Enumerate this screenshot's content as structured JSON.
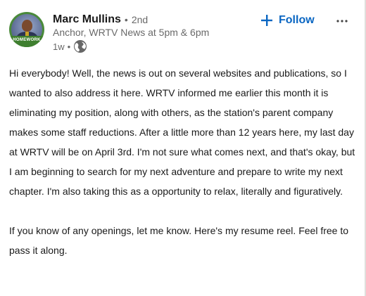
{
  "author": {
    "name": "Marc Mullins",
    "separator": "•",
    "connection_degree": "2nd",
    "headline": "Anchor, WRTV News at 5pm & 6pm",
    "avatar_banner_text": "HOMEWORK",
    "avatar_icon": "profile-photo"
  },
  "post_meta": {
    "time_ago": "1w",
    "separator": "•",
    "visibility_icon": "globe-icon"
  },
  "actions": {
    "follow_label": "Follow",
    "follow_icon": "plus-icon",
    "more_icon": "ellipsis-icon"
  },
  "content": {
    "paragraphs": [
      "Hi everybody! Well, the news is out on several websites and publications, so I wanted to also address it here. WRTV informed me earlier this month it is eliminating my position, along with others, as the station's parent company makes some staff reductions. After a little more than 12 years here, my last day at WRTV will be on April 3rd. I'm not sure what comes next, and that's okay, but I am beginning to search for my next adventure and prepare to write my next chapter. I'm also taking this as a opportunity to relax, literally and figuratively.",
      "If you know of any openings, let me know. Here's my resume reel. Feel free to pass it along."
    ]
  },
  "colors": {
    "accent": "#0a66c2",
    "secondary_text": "#666666",
    "primary_text": "#1a1a1a",
    "avatar_ring": "#3f7f2f"
  }
}
